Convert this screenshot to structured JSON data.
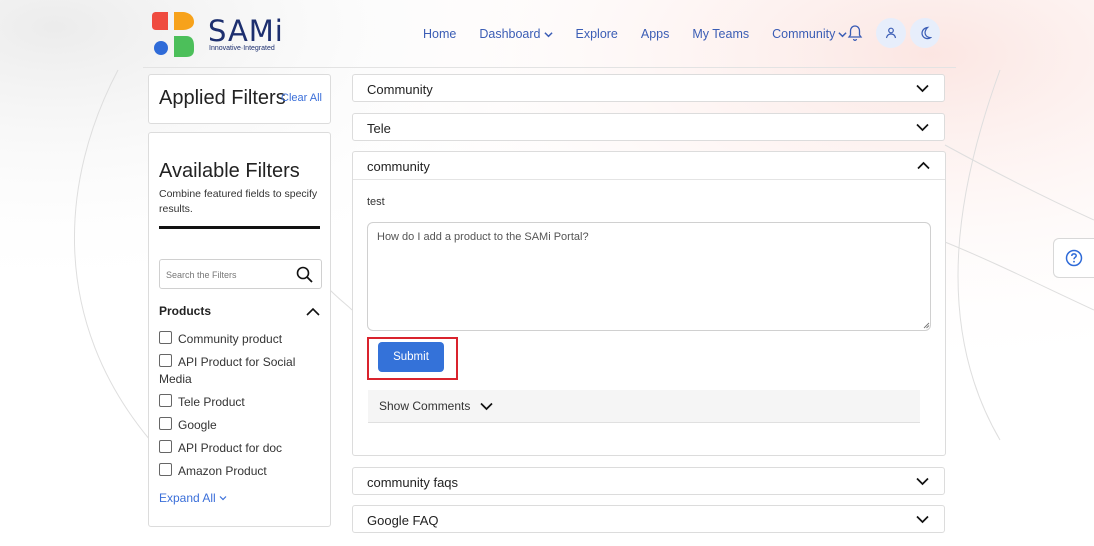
{
  "header": {
    "logo_text": "SAMi",
    "logo_tagline": "Innovative·Integrated",
    "nav": [
      {
        "label": "Home",
        "dropdown": false
      },
      {
        "label": "Dashboard",
        "dropdown": true
      },
      {
        "label": "Explore",
        "dropdown": false
      },
      {
        "label": "Apps",
        "dropdown": false
      },
      {
        "label": "My Teams",
        "dropdown": false
      },
      {
        "label": "Community",
        "dropdown": true
      }
    ],
    "icons": [
      "bell-icon",
      "user-icon",
      "moon-icon"
    ]
  },
  "sidebar": {
    "applied": {
      "title": "Applied Filters",
      "clear_label": "Clear All"
    },
    "available": {
      "title": "Available Filters",
      "description": "Combine featured fields to specify results.",
      "search_placeholder": "Search the Filters",
      "products_heading": "Products",
      "products": [
        "Community product",
        "API Product for Social Media",
        "Tele Product",
        "Google",
        "API Product for doc",
        "Amazon Product"
      ],
      "expand_label": "Expand All"
    }
  },
  "main": {
    "accordion_top": [
      "Community",
      "Tele"
    ],
    "open_section": {
      "title": "community",
      "answer": "test",
      "question_placeholder": "How do I add a product to the SAMi Portal?",
      "submit_label": "Submit",
      "comments_label": "Show Comments"
    },
    "accordion_bottom": [
      "community faqs",
      "Google FAQ"
    ]
  },
  "colors": {
    "accent": "#3472d9",
    "nav_text": "#3b5db5",
    "highlight": "#d9232d",
    "logo_red": "#ef4b3f",
    "logo_orange": "#f7a21b",
    "logo_blue": "#2f6bd8",
    "logo_green": "#4cbf5a"
  }
}
